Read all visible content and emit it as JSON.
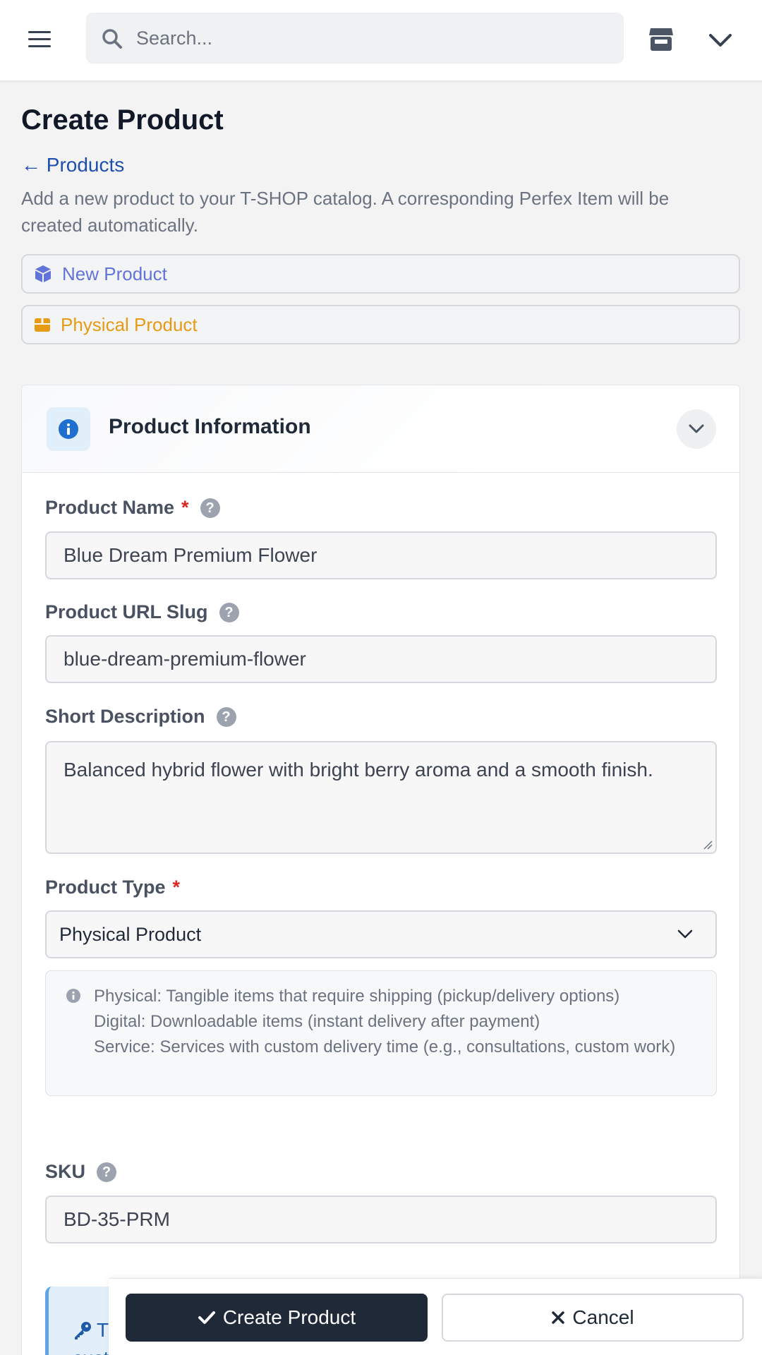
{
  "topbar": {
    "search_placeholder": "Search...",
    "icons": [
      "menu-icon",
      "search-icon",
      "store-icon",
      "chevron-down-icon"
    ]
  },
  "header": {
    "title": "Create Product",
    "back_link": "← Products",
    "description": "Add a new product to your T-SHOP catalog. A corresponding Perfex Item will be created automatically."
  },
  "badges": {
    "new_product": "New Product",
    "physical_product": "Physical Product"
  },
  "card": {
    "title": "Product Information",
    "fields": {
      "name": {
        "label": "Product Name",
        "required_mark": "*",
        "help": "?",
        "value": "Blue Dream Premium Flower"
      },
      "slug": {
        "label": "Product URL Slug",
        "help": "?",
        "value": "blue-dream-premium-flower"
      },
      "short_description": {
        "label": "Short Description",
        "help": "?",
        "value": "Balanced hybrid flower with bright berry aroma and a smooth finish."
      },
      "type": {
        "label": "Product Type",
        "required_mark": "*",
        "selected": "Physical Product",
        "info_lines": [
          "Physical: Tangible items that require shipping (pickup/delivery options)",
          "Digital: Downloadable items (instant delivery after payment)",
          "Service: Services with custom delivery time (e.g., consultations, custom work)"
        ]
      },
      "sku": {
        "label": "SKU",
        "help": "?",
        "value": "BD-35-PRM"
      }
    },
    "key_note_visible": "T",
    "key_note_line2_visible": "cust"
  },
  "actions": {
    "create_label": "Create Product",
    "cancel_label": "Cancel"
  },
  "colors": {
    "primary_dark": "#1f2937",
    "link_blue": "#1e4fad",
    "new_badge": "#6273d9",
    "physical_badge": "#e79a14",
    "required": "#dc2626"
  }
}
